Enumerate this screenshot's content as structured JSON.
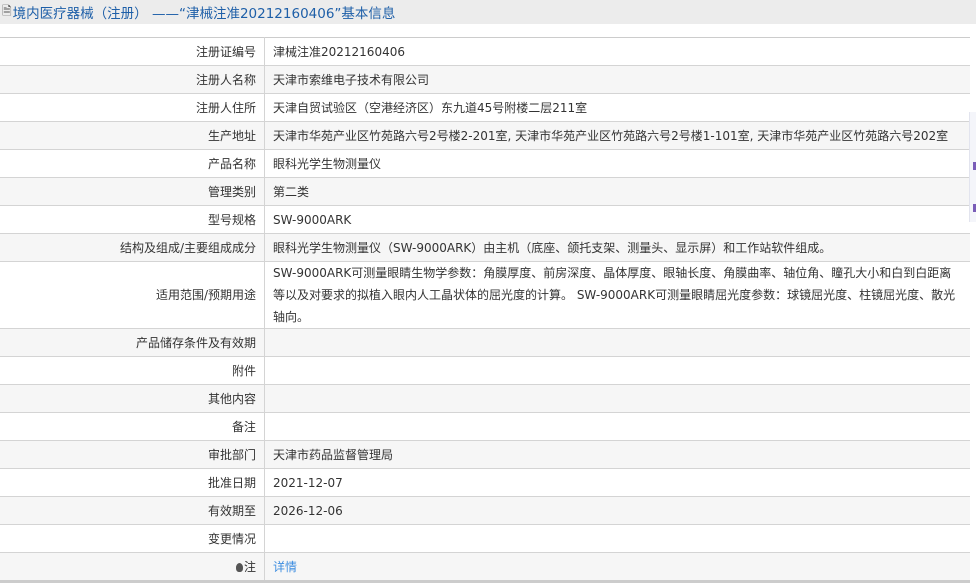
{
  "header": {
    "title": "境内医疗器械（注册） ——“津械注准20212160406”基本信息"
  },
  "rows": [
    {
      "label": "注册证编号",
      "value": "津械注准20212160406"
    },
    {
      "label": "注册人名称",
      "value": "天津市索维电子技术有限公司"
    },
    {
      "label": "注册人住所",
      "value": "天津自贸试验区（空港经济区）东九道45号附楼二层211室"
    },
    {
      "label": "生产地址",
      "value": "天津市华苑产业区竹苑路六号2号楼2-201室, 天津市华苑产业区竹苑路六号2号楼1-101室, 天津市华苑产业区竹苑路六号202室"
    },
    {
      "label": "产品名称",
      "value": "眼科光学生物测量仪"
    },
    {
      "label": "管理类别",
      "value": "第二类"
    },
    {
      "label": "型号规格",
      "value": "SW-9000ARK"
    },
    {
      "label": "结构及组成/主要组成成分",
      "value": "眼科光学生物测量仪（SW-9000ARK）由主机（底座、颌托支架、测量头、显示屏）和工作站软件组成。"
    },
    {
      "label": "适用范围/预期用途",
      "value": "SW-9000ARK可测量眼睛生物学参数：角膜厚度、前房深度、晶体厚度、眼轴长度、角膜曲率、轴位角、瞳孔大小和白到白距离等以及对要求的拟植入眼内人工晶状体的屈光度的计算。 SW-9000ARK可测量眼睛屈光度参数：球镜屈光度、柱镜屈光度、散光轴向。"
    },
    {
      "label": "产品储存条件及有效期",
      "value": ""
    },
    {
      "label": "附件",
      "value": ""
    },
    {
      "label": "其他内容",
      "value": ""
    },
    {
      "label": "备注",
      "value": ""
    },
    {
      "label": "审批部门",
      "value": "天津市药品监督管理局"
    },
    {
      "label": "批准日期",
      "value": "2021-12-07"
    },
    {
      "label": "有效期至",
      "value": "2026-12-06"
    },
    {
      "label": "变更情况",
      "value": ""
    }
  ],
  "note": {
    "label": "注",
    "link": "详情"
  }
}
